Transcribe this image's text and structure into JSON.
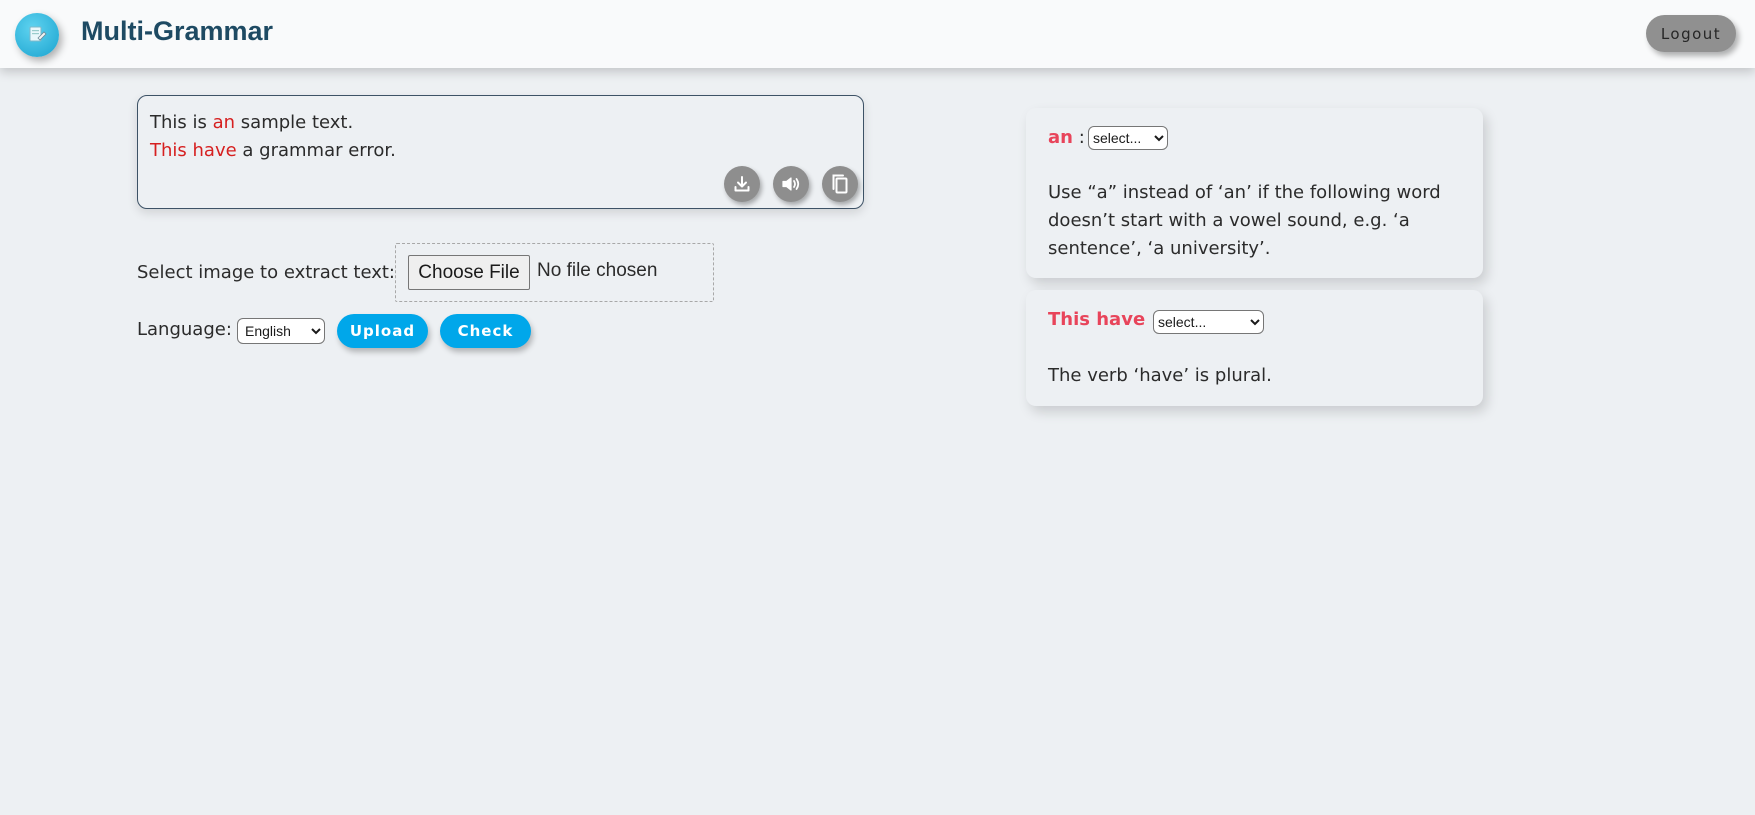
{
  "header": {
    "title": "Multi-Grammar",
    "logo_icon": "document-edit-icon",
    "logout_label": "Logout"
  },
  "editor": {
    "line1": {
      "before": "This is ",
      "error": "an",
      "after": " sample text."
    },
    "line2": {
      "error": "This have",
      "after": " a grammar error."
    },
    "tools": [
      "download-icon",
      "speaker-icon",
      "copy-icon"
    ]
  },
  "image_extract": {
    "label": "Select image to extract text:",
    "choose_label": "Choose File",
    "status": "No file chosen"
  },
  "language": {
    "label": "Language:",
    "selected": "English"
  },
  "actions": {
    "upload_label": "Upload",
    "check_label": "Check"
  },
  "suggestions": [
    {
      "word": "an",
      "separator": ":",
      "select_value": "select...",
      "message": "Use “a” instead of ‘an’ if the following word doesn’t start with a vowel sound, e.g. ‘a sentence’, ‘a university’."
    },
    {
      "word": "This have",
      "separator": ":",
      "select_value": "select...",
      "message": "The verb ‘have’ is plural."
    }
  ],
  "colors": {
    "background": "#edf0f3",
    "title": "#1e4a63",
    "error_text": "#d62020",
    "suggestion_word": "#e8445a",
    "primary_button": "#00a7ea",
    "logout_button": "#909090"
  }
}
